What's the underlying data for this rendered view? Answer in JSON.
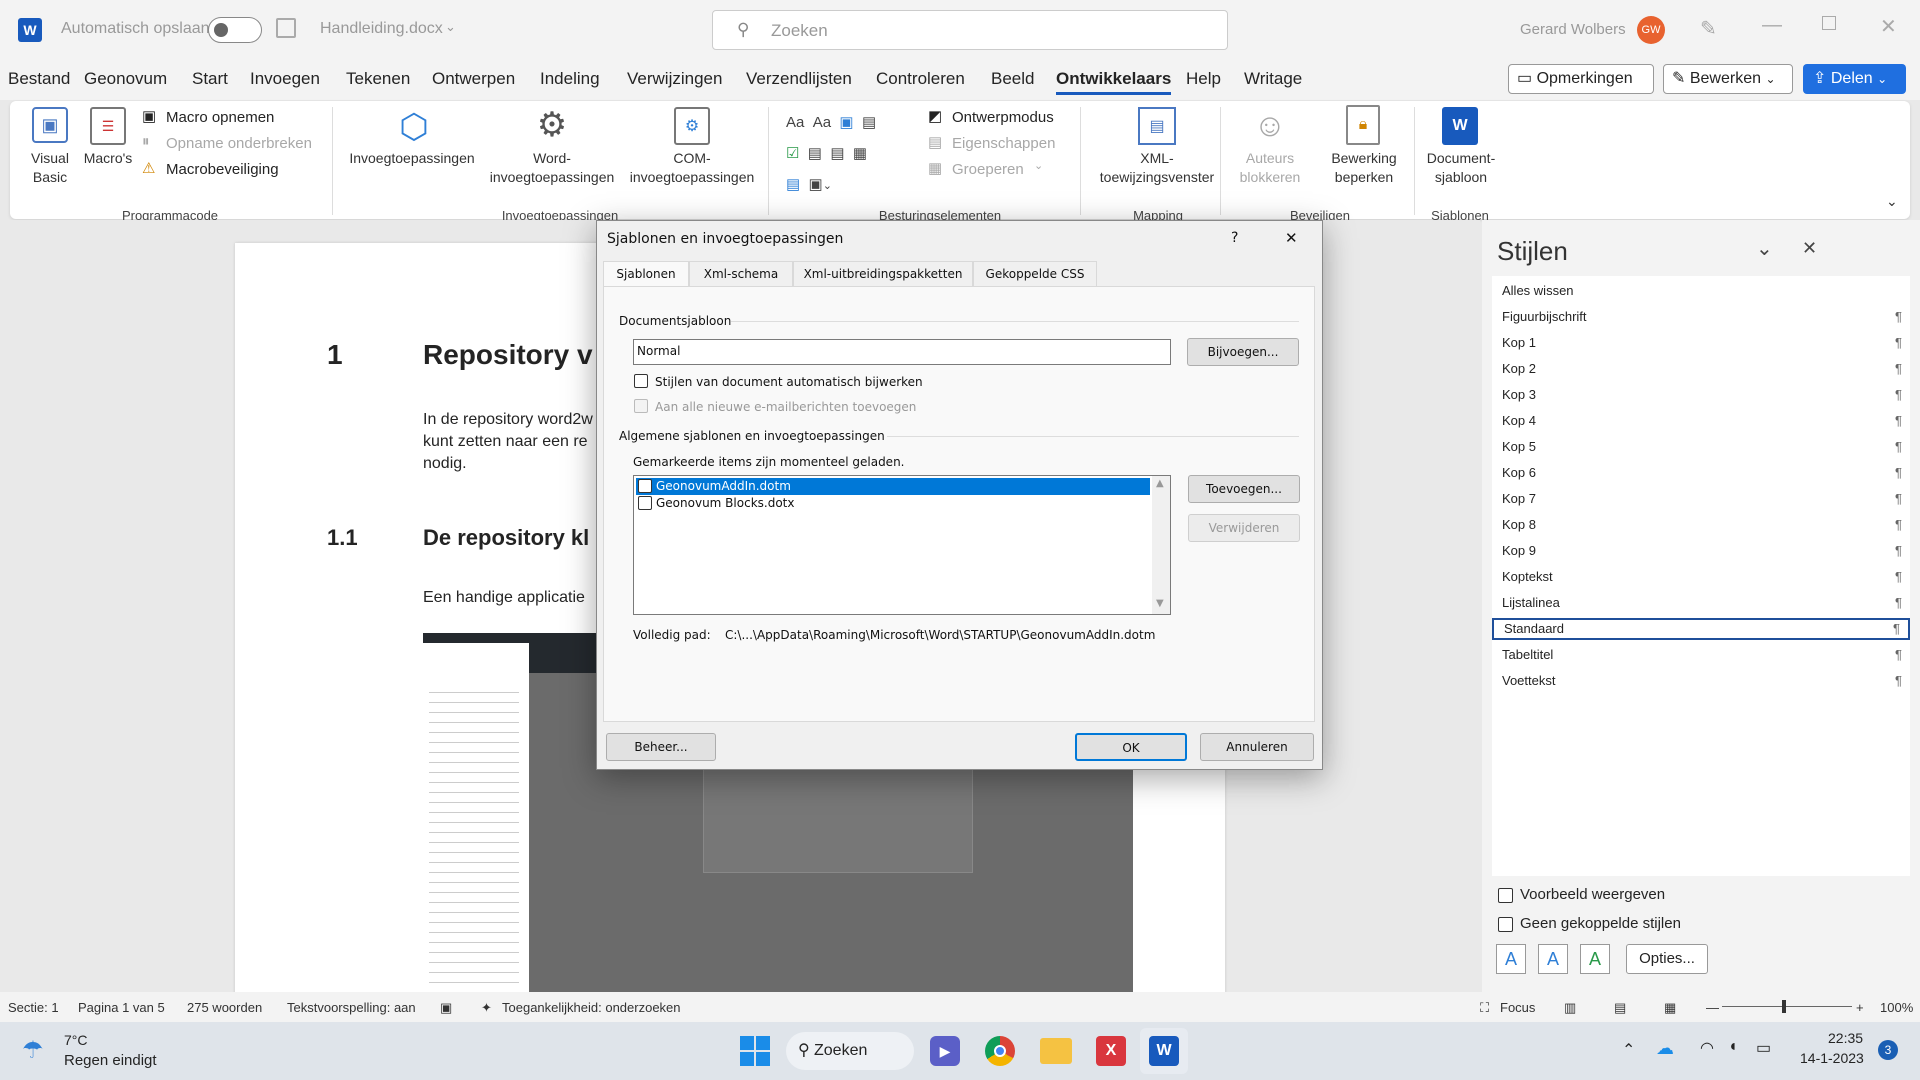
{
  "titlebar": {
    "app_icon": "W",
    "autosave_label": "Automatisch opslaan",
    "filename": "Handleiding.docx",
    "search_placeholder": "Zoeken",
    "user_name": "Gerard Wolbers",
    "user_initials": "GW"
  },
  "menubar": {
    "items": [
      "Bestand",
      "Geonovum",
      "Start",
      "Invoegen",
      "Tekenen",
      "Ontwerpen",
      "Indeling",
      "Verwijzingen",
      "Verzendlijsten",
      "Controleren",
      "Beeld",
      "Ontwikkelaars",
      "Help",
      "Writage"
    ],
    "active": "Ontwikkelaars",
    "opmerkingen": "Opmerkingen",
    "bewerken": "Bewerken",
    "delen": "Delen"
  },
  "ribbon": {
    "visual_basic": "Visual\nBasic",
    "macros": "Macro's",
    "macro_opnemen": "Macro opnemen",
    "opname_onderbreken": "Opname onderbreken",
    "macrobeveiliging": "Macrobeveiliging",
    "group_programmacode": "Programmacode",
    "invoegtoepassingen": "Invoegtoepassingen",
    "word_invoeg": "Word-\ninvoegtoepassingen",
    "com_invoeg": "COM-\ninvoegtoepassingen",
    "group_invoeg": "Invoegtoepassingen",
    "ontwerpmodus": "Ontwerpmodus",
    "eigenschappen": "Eigenschappen",
    "groeperen": "Groeperen",
    "group_besturing": "Besturingselementen",
    "xml_toewijzing": "XML-\ntoewijzingsvenster",
    "group_mapping": "Mapping",
    "auteurs_blokkeren": "Auteurs\nblokkeren",
    "bewerking_beperken": "Bewerking\nbeperken",
    "group_beveiligen": "Beveiligen",
    "document_sjabloon": "Document-\nsjabloon",
    "group_sjablonen": "Sjablonen"
  },
  "document": {
    "h1_num": "1",
    "h1_text": "Repository v",
    "p1_l1": "In de repository word2w",
    "p1_l2": "kunt zetten naar een re",
    "p1_l3": "nodig.",
    "h2_num": "1.1",
    "h2_text": "De repository kl",
    "p2": "Een handige applicatie"
  },
  "dialog": {
    "title": "Sjablonen en invoegtoepassingen",
    "help": "?",
    "tabs": [
      "Sjablonen",
      "Xml-schema",
      "Xml-uitbreidingspakketten",
      "Gekoppelde CSS"
    ],
    "documentsjabloon_label": "Documentsjabloon",
    "documentsjabloon_value": "Normal",
    "bijvoegen": "Bijvoegen...",
    "auto_update": "Stijlen van document automatisch bijwerken",
    "email_attach": "Aan alle nieuwe e-mailberichten toevoegen",
    "algemene_label": "Algemene sjablonen en invoegtoepassingen",
    "gemarkeerde": "Gemarkeerde items zijn momenteel geladen.",
    "items": [
      "GeonovumAddIn.dotm",
      "Geonovum Blocks.dotx"
    ],
    "toevoegen": "Toevoegen...",
    "verwijderen": "Verwijderen",
    "volledig_pad_label": "Volledig pad:",
    "volledig_pad_value": "C:\\...\\AppData\\Roaming\\Microsoft\\Word\\STARTUP\\GeonovumAddIn.dotm",
    "beheer": "Beheer...",
    "ok": "OK",
    "annuleren": "Annuleren"
  },
  "stijlen": {
    "title": "Stijlen",
    "items": [
      "Alles wissen",
      "Figuurbijschrift",
      "Kop 1",
      "Kop 2",
      "Kop 3",
      "Kop 4",
      "Kop 5",
      "Kop 6",
      "Kop 7",
      "Kop 8",
      "Kop 9",
      "Koptekst",
      "Lijstalinea",
      "Standaard",
      "Tabeltitel",
      "Voettekst"
    ],
    "selected": "Standaard",
    "pilcrow": "¶",
    "voorbeeld": "Voorbeeld weergeven",
    "geen_gekoppelde": "Geen gekoppelde stijlen",
    "opties": "Opties..."
  },
  "statusbar": {
    "sectie": "Sectie: 1",
    "pagina": "Pagina 1 van 5",
    "woorden": "275 woorden",
    "spelling": "Tekstvoorspelling: aan",
    "toegankelijkheid": "Toegankelijkheid: onderzoeken",
    "focus": "Focus",
    "zoom": "100%"
  },
  "taskbar": {
    "temp": "7°C",
    "weather": "Regen eindigt",
    "search": "Zoeken",
    "time": "22:35",
    "date": "14-1-2023",
    "badge": "3"
  }
}
